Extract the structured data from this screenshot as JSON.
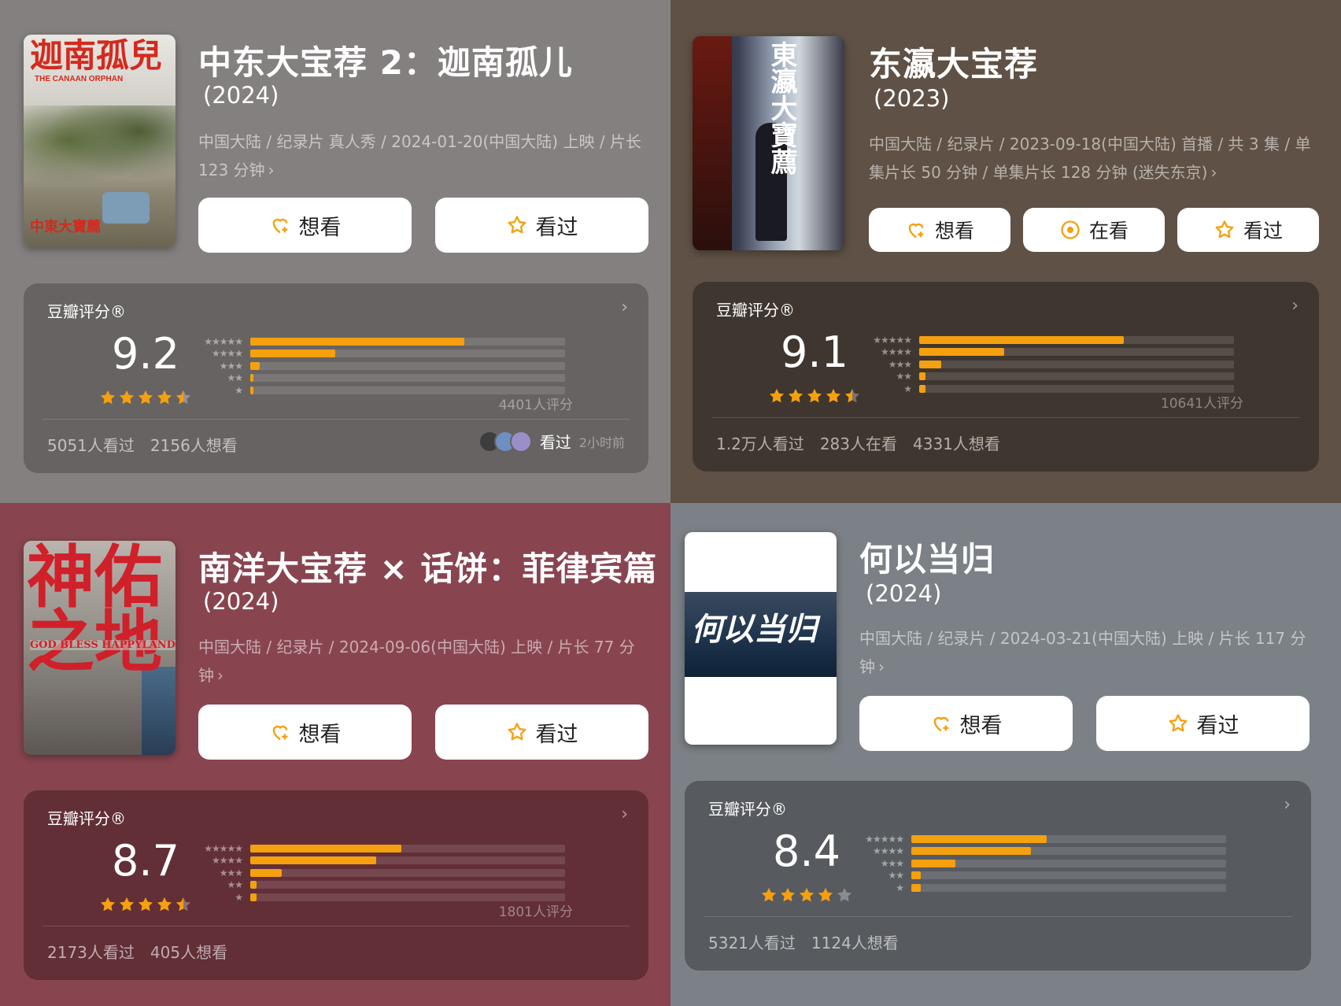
{
  "colors": {
    "accent": "#f5a00e",
    "button_bg": "#ffffff"
  },
  "cards": [
    {
      "poster": {
        "title_text": "迦南孤兒",
        "subtitle_text": "THE CANAAN ORPHAN",
        "badge_text": "中東大寶薦"
      },
      "title": "中东大宝荐 2：迦南孤儿",
      "year": "(2024)",
      "meta": "中国大陆 / 纪录片 真人秀 / 2024-01-20(中国大陆) 上映 / 片长123 分钟",
      "buttons": [
        {
          "label": "想看",
          "icon": "heart-plus-icon"
        },
        {
          "label": "看过",
          "icon": "star-outline-icon"
        }
      ],
      "rating": {
        "label": "豆瓣评分®",
        "score": "9.2",
        "stars": 4.5,
        "distribution": [
          0.68,
          0.27,
          0.03,
          0.01,
          0.01
        ],
        "count": "4401人评分",
        "stats": [
          "5051人看过",
          "2156人想看"
        ],
        "friend_label": "看过",
        "friend_time": "2小时前"
      }
    },
    {
      "poster": {
        "title_text": "東瀛大寶薦",
        "subtitle_text": ""
      },
      "title": "东瀛大宝荐",
      "year": "(2023)",
      "meta": "中国大陆 / 纪录片 / 2023-09-18(中国大陆) 首播 / 共 3 集 / 单集片长 50 分钟 / 单集片长 128 分钟 (迷失东京)",
      "buttons": [
        {
          "label": "想看",
          "icon": "heart-plus-icon"
        },
        {
          "label": "在看",
          "icon": "circle-dot-icon"
        },
        {
          "label": "看过",
          "icon": "star-outline-icon"
        }
      ],
      "rating": {
        "label": "豆瓣评分®",
        "score": "9.1",
        "stars": 4.5,
        "distribution": [
          0.65,
          0.27,
          0.07,
          0.02,
          0.02
        ],
        "count": "10641人评分",
        "stats": [
          "1.2万人看过",
          "283人在看",
          "4331人想看"
        ]
      }
    },
    {
      "poster": {
        "title_text": "神佑之地",
        "subtitle_text": "GOD BLESS HAPPYLAND"
      },
      "title": "南洋大宝荐 × 话饼：菲律宾篇",
      "year": "(2024)",
      "meta": "中国大陆 / 纪录片 / 2024-09-06(中国大陆) 上映 / 片长 77 分钟",
      "buttons": [
        {
          "label": "想看",
          "icon": "heart-plus-icon"
        },
        {
          "label": "看过",
          "icon": "star-outline-icon"
        }
      ],
      "rating": {
        "label": "豆瓣评分®",
        "score": "8.7",
        "stars": 4.5,
        "distribution": [
          0.48,
          0.4,
          0.1,
          0.02,
          0.02
        ],
        "count": "1801人评分",
        "stats": [
          "2173人看过",
          "405人想看"
        ]
      }
    },
    {
      "poster": {
        "title_text": "何以当归",
        "subtitle_text": ""
      },
      "title": "何以当归",
      "year": "(2024)",
      "meta": "中国大陆 / 纪录片 / 2024-03-21(中国大陆) 上映 / 片长 117 分钟",
      "buttons": [
        {
          "label": "想看",
          "icon": "heart-plus-icon"
        },
        {
          "label": "看过",
          "icon": "star-outline-icon"
        }
      ],
      "rating": {
        "label": "豆瓣评分®",
        "score": "8.4",
        "stars": 4,
        "distribution": [
          0.43,
          0.38,
          0.14,
          0.03,
          0.03
        ],
        "count": "",
        "stats": [
          "5321人看过",
          "1124人想看"
        ]
      }
    }
  ]
}
